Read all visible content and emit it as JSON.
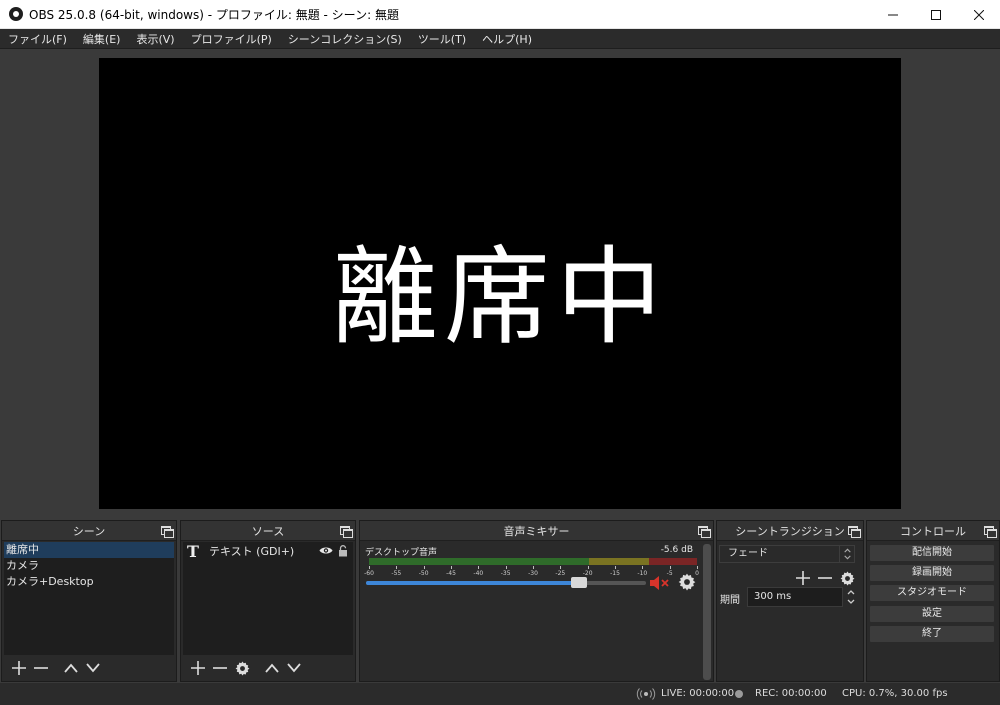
{
  "window": {
    "title": "OBS 25.0.8 (64-bit, windows) - プロファイル: 無題 - シーン: 無題",
    "controls": [
      "minimize-icon",
      "maximize-icon",
      "close-icon"
    ]
  },
  "menu": [
    "ファイル(F)",
    "編集(E)",
    "表示(V)",
    "プロファイル(P)",
    "シーンコレクション(S)",
    "ツール(T)",
    "ヘルプ(H)"
  ],
  "preview": {
    "text": "離席中"
  },
  "scenes": {
    "title": "シーン",
    "items": [
      "離席中",
      "カメラ",
      "カメラ+Desktop"
    ],
    "selected": 0
  },
  "sources": {
    "title": "ソース",
    "items": [
      {
        "label": "テキスト (GDI+)",
        "icon": "text-source-icon",
        "visible": true,
        "locked": false
      }
    ]
  },
  "mixer": {
    "title": "音声ミキサー",
    "channel": {
      "name": "デスクトップ音声",
      "db": "-5.6 dB",
      "ticks": [
        "-60",
        "-55",
        "-50",
        "-45",
        "-40",
        "-35",
        "-30",
        "-25",
        "-20",
        "-15",
        "-10",
        "-5",
        "0"
      ],
      "volume_fraction": 0.76,
      "muted": true
    }
  },
  "transitions": {
    "title": "シーントランジション",
    "selected": "フェード",
    "duration_label": "期間",
    "duration_value": "300 ms"
  },
  "controls": {
    "title": "コントロール",
    "buttons": [
      "配信開始",
      "録画開始",
      "スタジオモード",
      "設定",
      "終了"
    ]
  },
  "status": {
    "live": "LIVE: 00:00:00",
    "rec": "REC: 00:00:00",
    "cpu": "CPU: 0.7%, 30.00 fps"
  },
  "colors": {
    "selection": "#1f3d5c",
    "slider": "#3d86d8",
    "mute": "#d9342b"
  }
}
